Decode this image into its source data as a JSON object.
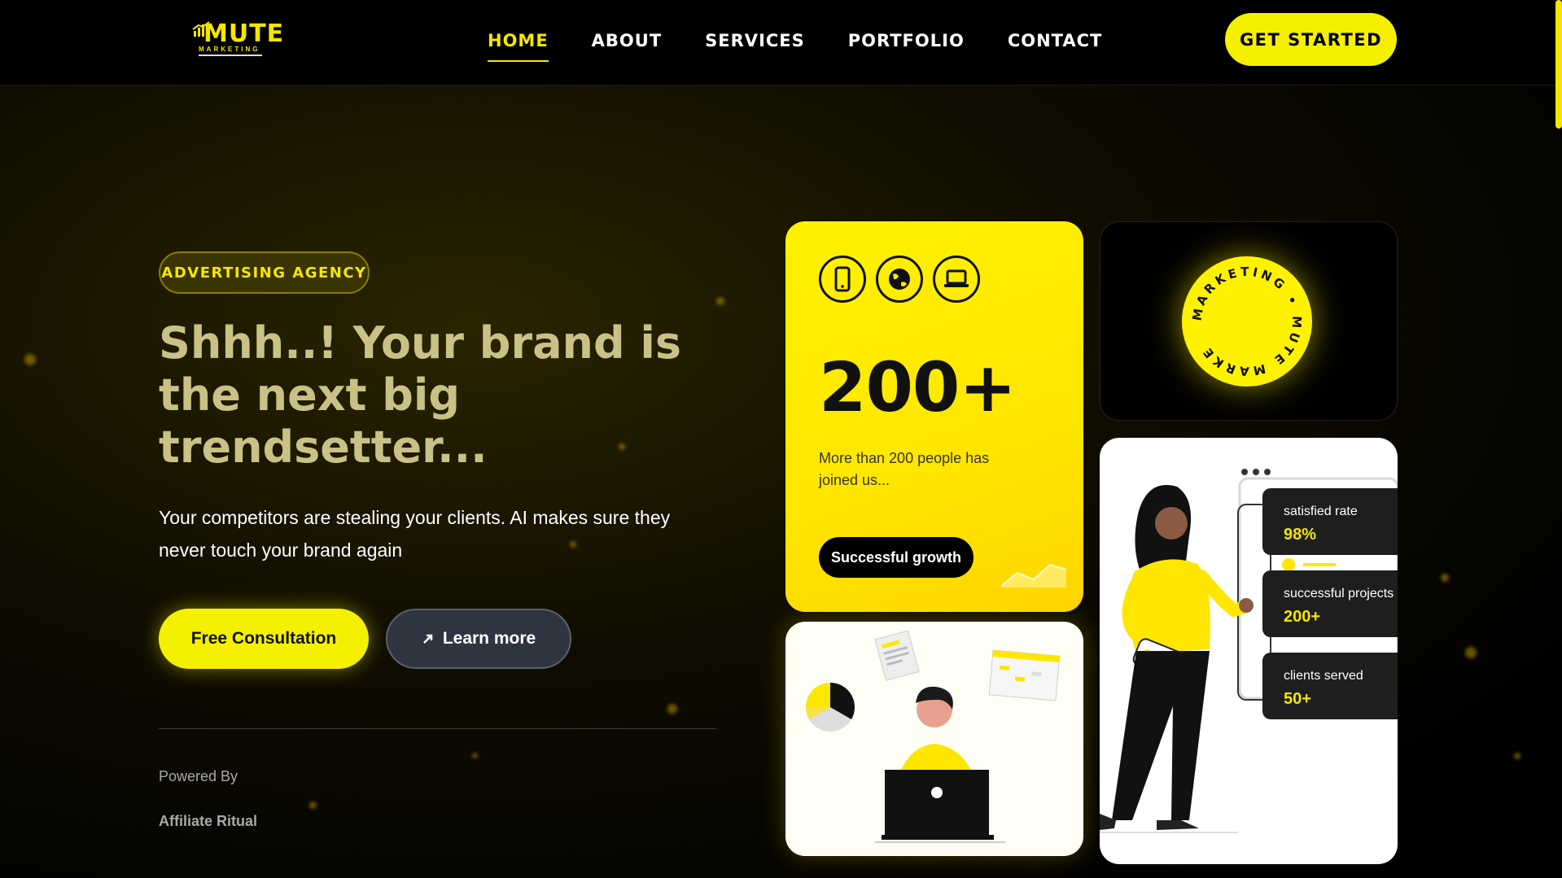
{
  "header": {
    "logo_text": "MUTE",
    "logo_sub": "MARKETING",
    "nav": [
      {
        "label": "HOME",
        "active": true
      },
      {
        "label": "ABOUT"
      },
      {
        "label": "SERVICES"
      },
      {
        "label": "PORTFOLIO"
      },
      {
        "label": "CONTACT"
      }
    ],
    "cta_label": "GET STARTED"
  },
  "hero": {
    "badge": "ADVERTISING AGENCY",
    "title": "Shhh..! Your brand is the next big trendsetter...",
    "subtitle": "Your competitors are stealing your clients. AI makes sure they never touch your brand again",
    "primary_button": "Free Consultation",
    "secondary_button": "Learn more",
    "secondary_icon": "arrow-up-right-icon",
    "powered_label": "Powered By",
    "powered_name": "Affiliate Ritual"
  },
  "cards": {
    "stat_card": {
      "icons": [
        "phone-icon",
        "globe-icon",
        "laptop-icon"
      ],
      "value": "200+",
      "description": "More than 200 people has joined us...",
      "button": "Successful growth"
    },
    "logo_card": {
      "ring_text": "MARKETING • MUTE MARKE"
    },
    "stats": [
      {
        "label": "satisfied rate",
        "value": "98%"
      },
      {
        "label": "successful projects",
        "value": "200+"
      },
      {
        "label": "clients served",
        "value": "50+"
      }
    ]
  },
  "colors": {
    "accent": "#f5e600",
    "background": "#000000",
    "button_dark": "#2e3440"
  }
}
